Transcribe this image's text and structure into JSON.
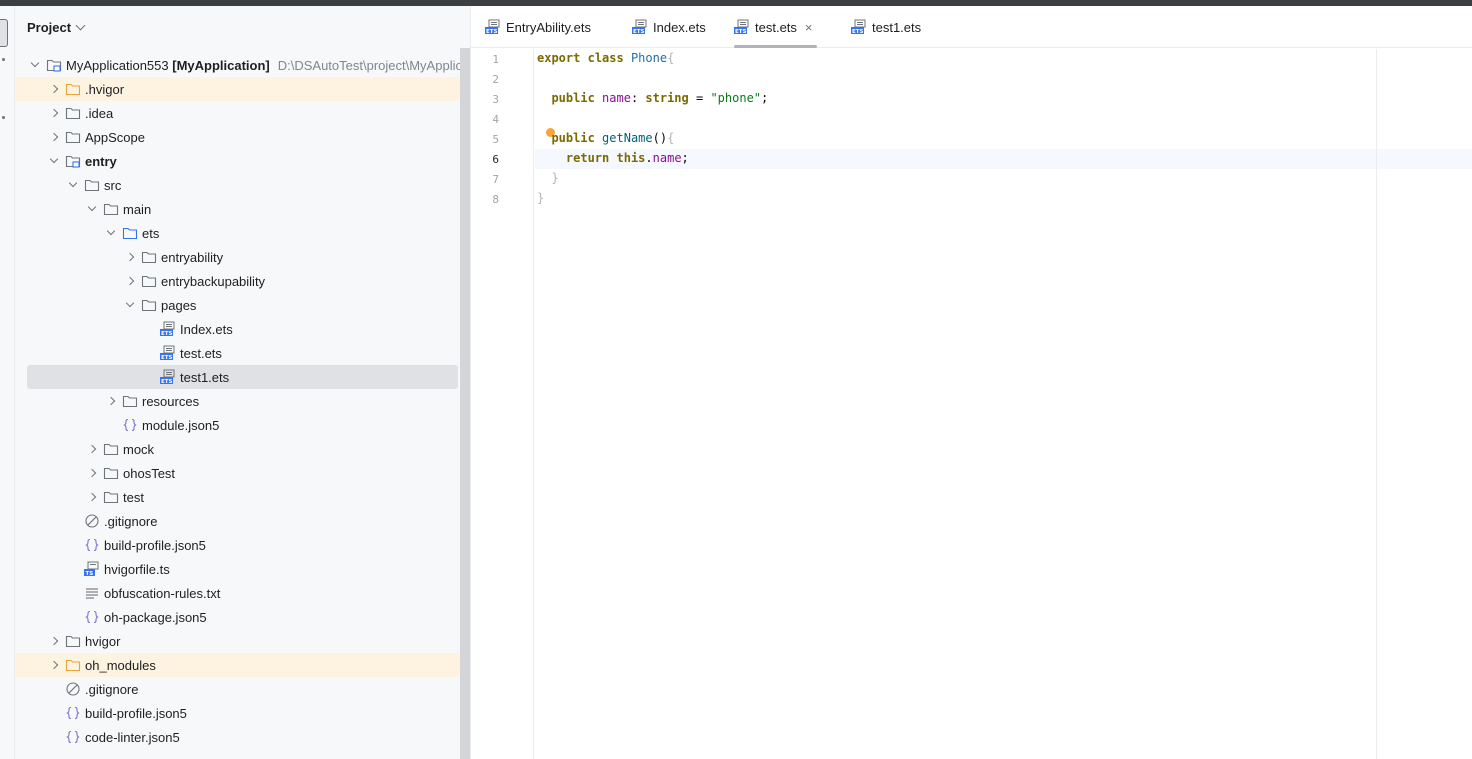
{
  "panel": {
    "title": "Project"
  },
  "tree": [
    {
      "label": "MyApplication553",
      "suffix": " [MyApplication]",
      "path": "D:\\DSAutoTest\\project\\MyApplic",
      "depth": 0,
      "arrow": "open",
      "icon": "module-folder-icon"
    },
    {
      "label": ".hvigor",
      "depth": 1,
      "arrow": "closed",
      "icon": "folder-excluded-icon",
      "hl": true
    },
    {
      "label": ".idea",
      "depth": 1,
      "arrow": "closed",
      "icon": "folder-icon"
    },
    {
      "label": "AppScope",
      "depth": 1,
      "arrow": "closed",
      "icon": "folder-icon"
    },
    {
      "label": "entry",
      "depth": 1,
      "arrow": "open",
      "icon": "module-folder-icon",
      "bold": true
    },
    {
      "label": "src",
      "depth": 2,
      "arrow": "open",
      "icon": "folder-icon"
    },
    {
      "label": "main",
      "depth": 3,
      "arrow": "open",
      "icon": "folder-icon"
    },
    {
      "label": "ets",
      "depth": 4,
      "arrow": "open",
      "icon": "source-folder-icon"
    },
    {
      "label": "entryability",
      "depth": 5,
      "arrow": "closed",
      "icon": "folder-icon"
    },
    {
      "label": "entrybackupability",
      "depth": 5,
      "arrow": "closed",
      "icon": "folder-icon"
    },
    {
      "label": "pages",
      "depth": 5,
      "arrow": "open",
      "icon": "folder-icon"
    },
    {
      "label": "Index.ets",
      "depth": 6,
      "arrow": "none",
      "icon": "ets-file-icon"
    },
    {
      "label": "test.ets",
      "depth": 6,
      "arrow": "none",
      "icon": "ets-file-icon"
    },
    {
      "label": "test1.ets",
      "depth": 6,
      "arrow": "none",
      "icon": "ets-file-icon",
      "sel": true
    },
    {
      "label": "resources",
      "depth": 4,
      "arrow": "closed",
      "icon": "folder-icon"
    },
    {
      "label": "module.json5",
      "depth": 4,
      "arrow": "none",
      "icon": "json-file-icon"
    },
    {
      "label": "mock",
      "depth": 3,
      "arrow": "closed",
      "icon": "folder-icon"
    },
    {
      "label": "ohosTest",
      "depth": 3,
      "arrow": "closed",
      "icon": "folder-icon"
    },
    {
      "label": "test",
      "depth": 3,
      "arrow": "closed",
      "icon": "folder-icon"
    },
    {
      "label": ".gitignore",
      "depth": 2,
      "arrow": "none",
      "icon": "ignore-file-icon"
    },
    {
      "label": "build-profile.json5",
      "depth": 2,
      "arrow": "none",
      "icon": "json-file-icon"
    },
    {
      "label": "hvigorfile.ts",
      "depth": 2,
      "arrow": "none",
      "icon": "ts-file-icon"
    },
    {
      "label": "obfuscation-rules.txt",
      "depth": 2,
      "arrow": "none",
      "icon": "text-file-icon"
    },
    {
      "label": "oh-package.json5",
      "depth": 2,
      "arrow": "none",
      "icon": "json-file-icon"
    },
    {
      "label": "hvigor",
      "depth": 1,
      "arrow": "closed",
      "icon": "folder-icon"
    },
    {
      "label": "oh_modules",
      "depth": 1,
      "arrow": "closed",
      "icon": "folder-excluded-icon",
      "hl": true
    },
    {
      "label": ".gitignore",
      "depth": 1,
      "arrow": "none",
      "icon": "ignore-file-icon"
    },
    {
      "label": "build-profile.json5",
      "depth": 1,
      "arrow": "none",
      "icon": "json-file-icon"
    },
    {
      "label": "code-linter.json5",
      "depth": 1,
      "arrow": "none",
      "icon": "json-file-icon"
    }
  ],
  "tabs": [
    {
      "label": "EntryAbility.ets",
      "active": false
    },
    {
      "label": "Index.ets",
      "active": false
    },
    {
      "label": "test.ets",
      "active": true,
      "close": "×"
    },
    {
      "label": "test1.ets",
      "active": false
    }
  ],
  "editor": {
    "line_numbers": [
      "1",
      "2",
      "3",
      "4",
      "5",
      "6",
      "7",
      "8"
    ],
    "current_line": 6
  },
  "icon_text": {
    "ets": "ETS",
    "ts": "TS"
  },
  "colors": {
    "accent": "#3574f0",
    "excluded_folder": "#e8a33d",
    "selection": "#dfe1e5",
    "highlight_row": "#fdf3e0"
  }
}
